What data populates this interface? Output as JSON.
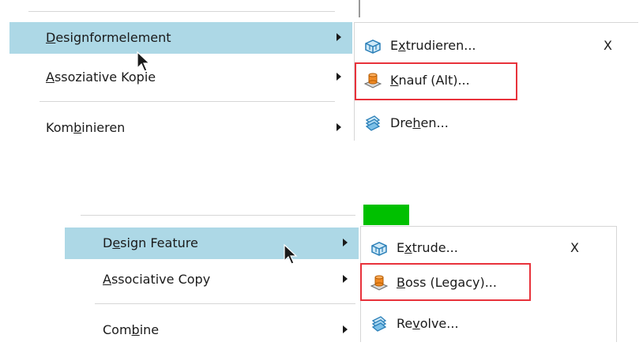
{
  "panels": [
    {
      "lang": "de",
      "main_menu": [
        {
          "pre": "",
          "u": "D",
          "post": "esignformelement",
          "has_submenu": true,
          "highlighted": true
        },
        {
          "pre": "",
          "u": "A",
          "post": "ssoziative Kopie",
          "has_submenu": true,
          "highlighted": false
        },
        {
          "pre": "Kom",
          "u": "b",
          "post": "inieren",
          "has_submenu": true,
          "highlighted": false
        }
      ],
      "submenu": [
        {
          "pre": "E",
          "u": "x",
          "post": "trudieren...",
          "shortcut": "X",
          "icon": "extrude-icon",
          "boxed": false
        },
        {
          "pre": "",
          "u": "K",
          "post": "nauf (Alt)...",
          "shortcut": "",
          "icon": "boss-icon",
          "boxed": true
        },
        {
          "pre": "Dre",
          "u": "h",
          "post": "en...",
          "shortcut": "",
          "icon": "revolve-icon",
          "boxed": false
        }
      ]
    },
    {
      "lang": "en",
      "main_menu": [
        {
          "pre": "D",
          "u": "e",
          "post": "sign Feature",
          "has_submenu": true,
          "highlighted": true
        },
        {
          "pre": "",
          "u": "A",
          "post": "ssociative Copy",
          "has_submenu": true,
          "highlighted": false
        },
        {
          "pre": "Com",
          "u": "b",
          "post": "ine",
          "has_submenu": true,
          "highlighted": false
        }
      ],
      "submenu": [
        {
          "pre": "E",
          "u": "x",
          "post": "trude...",
          "shortcut": "X",
          "icon": "extrude-icon",
          "boxed": false
        },
        {
          "pre": "",
          "u": "B",
          "post": "oss (Legacy)...",
          "shortcut": "",
          "icon": "boss-icon",
          "boxed": true
        },
        {
          "pre": "Re",
          "u": "v",
          "post": "olve...",
          "shortcut": "",
          "icon": "revolve-icon",
          "boxed": false
        }
      ]
    }
  ],
  "colors": {
    "highlight": "#add8e6",
    "callout_box": "#e8323b",
    "green_block": "#00c000"
  }
}
